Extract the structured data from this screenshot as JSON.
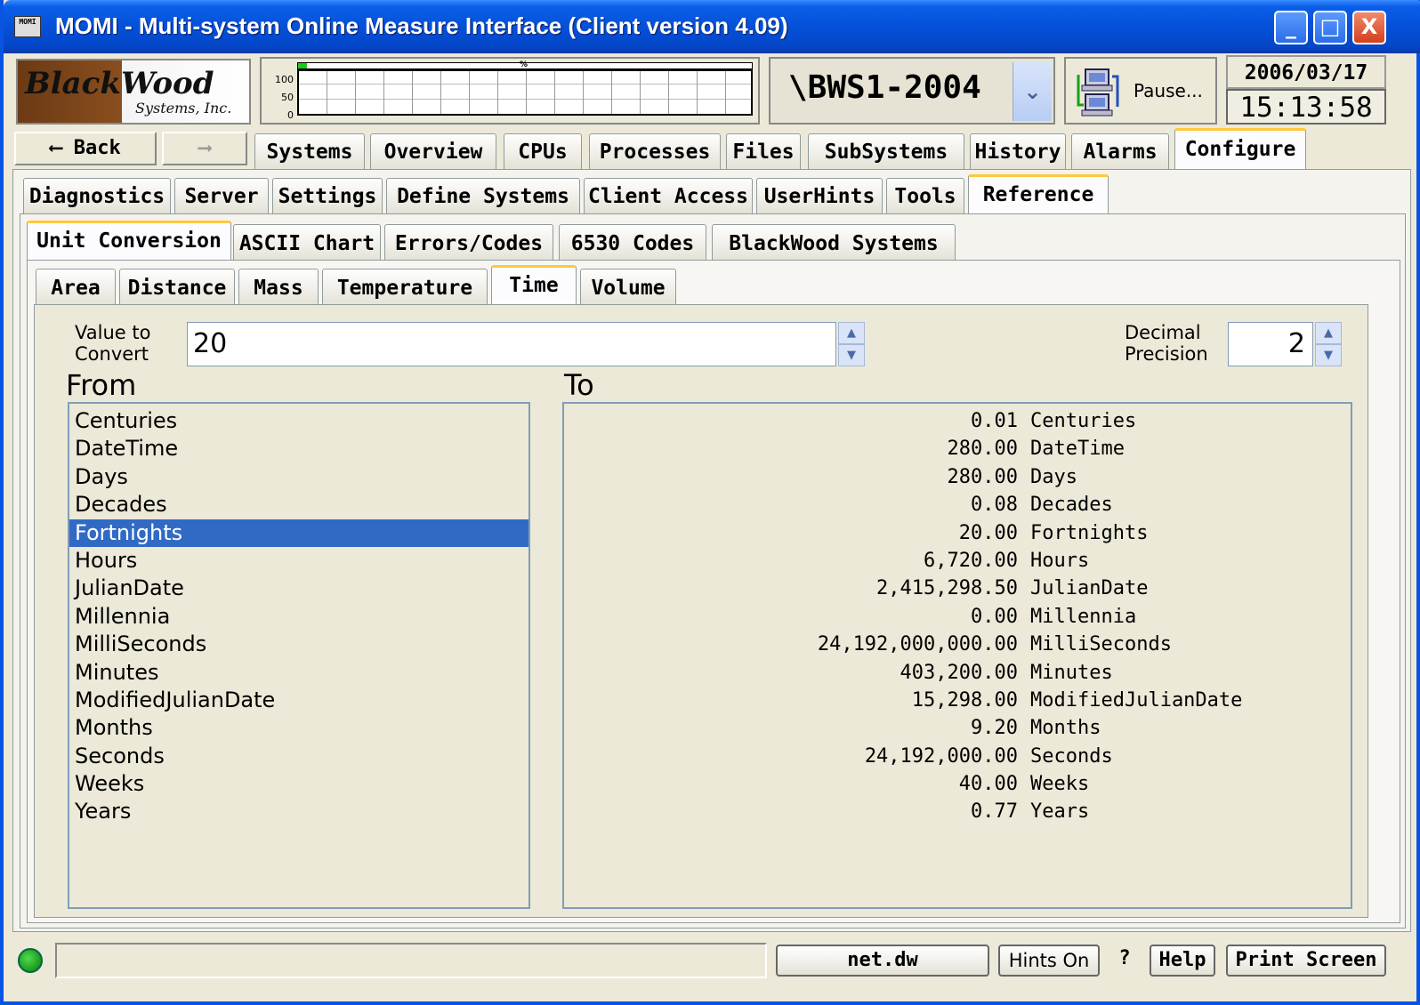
{
  "window": {
    "title": "MOMI - Multi-system Online Measure Interface (Client version 4.09)",
    "icon_text": "MOMI",
    "controls": {
      "minimize": "_",
      "maximize": "□",
      "close": "X"
    }
  },
  "header": {
    "logo": {
      "line1": "BlackWood",
      "line2": "Systems, Inc."
    },
    "graph": {
      "ticks": [
        "100",
        "50",
        "0"
      ],
      "percent_label": "%",
      "level_fraction": 0.02
    },
    "system_name": "\\BWS1-2004",
    "pause_label": "Pause...",
    "date": "2006/03/17",
    "time": "15:13:58"
  },
  "nav": {
    "back_label": "Back",
    "tabs": [
      "Systems",
      "Overview",
      "CPUs",
      "Processes",
      "Files",
      "SubSystems",
      "History",
      "Alarms",
      "Configure"
    ],
    "active_tab": "Configure"
  },
  "configure_tabs": [
    "Diagnostics",
    "Server",
    "Settings",
    "Define Systems",
    "Client Access",
    "UserHints",
    "Tools",
    "Reference"
  ],
  "reference_tabs": [
    "Unit Conversion",
    "ASCII Chart",
    "Errors/Codes",
    "6530 Codes",
    "BlackWood Systems"
  ],
  "unit_tabs": [
    "Area",
    "Distance",
    "Mass",
    "Temperature",
    "Time",
    "Volume"
  ],
  "converter": {
    "value_label_1": "Value to",
    "value_label_2": "Convert",
    "value": "20",
    "precision_label_1": "Decimal",
    "precision_label_2": "Precision",
    "precision": "2",
    "from_heading": "From",
    "to_heading": "To",
    "from_units": [
      "Centuries",
      "DateTime",
      "Days",
      "Decades",
      "Fortnights",
      "Hours",
      "JulianDate",
      "Millennia",
      "MilliSeconds",
      "Minutes",
      "ModifiedJulianDate",
      "Months",
      "Seconds",
      "Weeks",
      "Years"
    ],
    "selected_from": "Fortnights",
    "results": [
      {
        "value": "0.01",
        "unit": "Centuries"
      },
      {
        "value": "280.00",
        "unit": "DateTime"
      },
      {
        "value": "280.00",
        "unit": "Days"
      },
      {
        "value": "0.08",
        "unit": "Decades"
      },
      {
        "value": "20.00",
        "unit": "Fortnights"
      },
      {
        "value": "6,720.00",
        "unit": "Hours"
      },
      {
        "value": "2,415,298.50",
        "unit": "JulianDate"
      },
      {
        "value": "0.00",
        "unit": "Millennia"
      },
      {
        "value": "24,192,000,000.00",
        "unit": "MilliSeconds"
      },
      {
        "value": "403,200.00",
        "unit": "Minutes"
      },
      {
        "value": "15,298.00",
        "unit": "ModifiedJulianDate"
      },
      {
        "value": "9.20",
        "unit": "Months"
      },
      {
        "value": "24,192,000.00",
        "unit": "Seconds"
      },
      {
        "value": "40.00",
        "unit": "Weeks"
      },
      {
        "value": "0.77",
        "unit": "Years"
      }
    ]
  },
  "statusbar": {
    "status_text": "",
    "host": "net.dw",
    "hints": "Hints On",
    "question": "?",
    "help": "Help",
    "print": "Print Screen"
  }
}
